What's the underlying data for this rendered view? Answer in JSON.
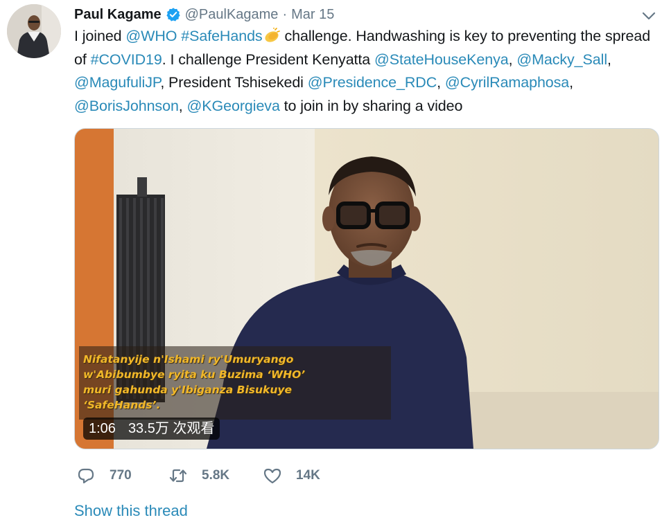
{
  "author": {
    "display_name": "Paul Kagame",
    "handle": "@PaulKagame",
    "separator": "·",
    "date": "Mar 15",
    "verified": true
  },
  "tweet": {
    "text_parts": [
      {
        "text": "I joined ",
        "link": false
      },
      {
        "text": "@WHO",
        "link": true
      },
      {
        "text": " ",
        "link": false
      },
      {
        "text": "#SafeHands",
        "link": true
      },
      {
        "text": "[emoji]",
        "link": false
      },
      {
        "text": " challenge. Handwashing is key to preventing the spread of ",
        "link": false
      },
      {
        "text": "#COVID19",
        "link": true
      },
      {
        "text": ". I challenge President Kenyatta ",
        "link": false
      },
      {
        "text": "@StateHouseKenya",
        "link": true
      },
      {
        "text": ", ",
        "link": false
      },
      {
        "text": "@Macky_Sall",
        "link": true
      },
      {
        "text": ", ",
        "link": false
      },
      {
        "text": "@MagufuliJP",
        "link": true
      },
      {
        "text": ", President Tshisekedi ",
        "link": false
      },
      {
        "text": "@Presidence_RDC",
        "link": true
      },
      {
        "text": ", ",
        "link": false
      },
      {
        "text": "@CyrilRamaphosa",
        "link": true
      },
      {
        "text": ", ",
        "link": false
      },
      {
        "text": "@BorisJohnson",
        "link": true
      },
      {
        "text": ", ",
        "link": false
      },
      {
        "text": "@KGeorgieva",
        "link": true
      },
      {
        "text": " to join in by sharing a video",
        "link": false
      }
    ],
    "emoji": "clapping-hands-emoji"
  },
  "video": {
    "subtitle": "Nifatanyije n'Ishami ry'Umuryango\nw'Abibumbye ryita ku Buzima ‘WHO’\nmuri gahunda y'Ibiganza Bisukuye\n‘SafeHands’.",
    "duration": "1:06",
    "views": "33.5万 次观看"
  },
  "actions": {
    "replies": "770",
    "retweets": "5.8K",
    "likes": "14K"
  },
  "show_thread": "Show this thread",
  "colors": {
    "link": "#2a8ab8",
    "muted": "#657786",
    "verified": "#1da1f2",
    "subtitle": "#f2b829"
  },
  "icons": {
    "caret": "chevron-down-icon",
    "verified": "verified-badge-icon",
    "reply": "reply-icon",
    "retweet": "retweet-icon",
    "like": "heart-icon"
  }
}
